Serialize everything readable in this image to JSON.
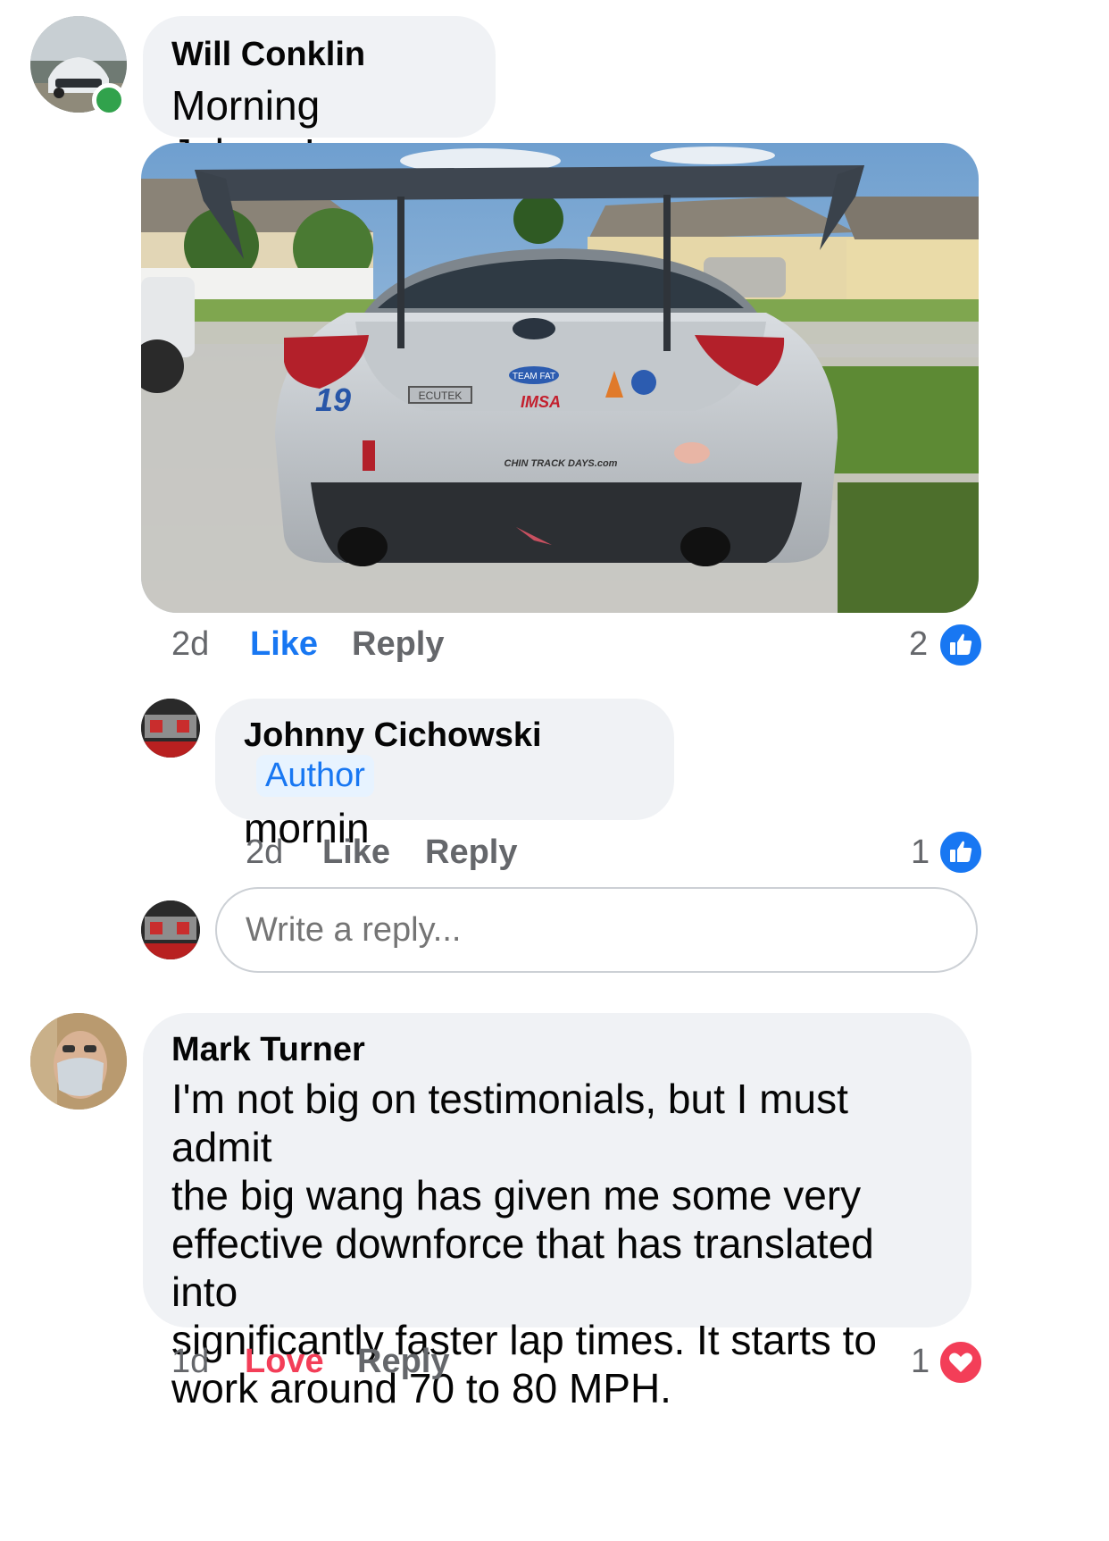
{
  "comments": [
    {
      "author": "Will Conklin",
      "text": "Morning Johnny!",
      "time": "2d",
      "like_label": "Like",
      "reply_label": "Reply",
      "reaction_count": "2",
      "reaction": "like-icon",
      "online": true,
      "photo": {
        "sticker_number": "19",
        "plate_text": "ECUTEK",
        "sticker_imsa": "IMSA",
        "sticker_team": "TEAM FAT",
        "sticker_bumper": "CHIN TRACK DAYS.com"
      }
    },
    {
      "author": "Mark Turner",
      "text": "I'm not big on testimonials, but I must admit the big wang has given me some very effective downforce that has translated into significantly faster lap times. It starts to work around 70 to 80 MPH.",
      "text_lines": [
        "I'm not big on testimonials, but I must admit",
        "the big wang has given me some very",
        "effective downforce that has translated into",
        "significantly faster lap times. It starts to",
        "work around 70 to 80 MPH."
      ],
      "time": "1d",
      "like_label": "Love",
      "reply_label": "Reply",
      "reaction_count": "1",
      "reaction": "love-icon"
    }
  ],
  "reply": {
    "author": "Johnny Cichowski",
    "badge": "Author",
    "text": "mornin",
    "time": "2d",
    "like_label": "Like",
    "reply_label": "Reply",
    "reaction_count": "1",
    "reaction": "like-icon"
  },
  "reply_input": {
    "placeholder": "Write a reply..."
  },
  "colors": {
    "accent": "#1877f2",
    "love": "#f33e58",
    "bubble": "#f0f2f5",
    "online": "#31a24c",
    "meta": "#65676b"
  }
}
